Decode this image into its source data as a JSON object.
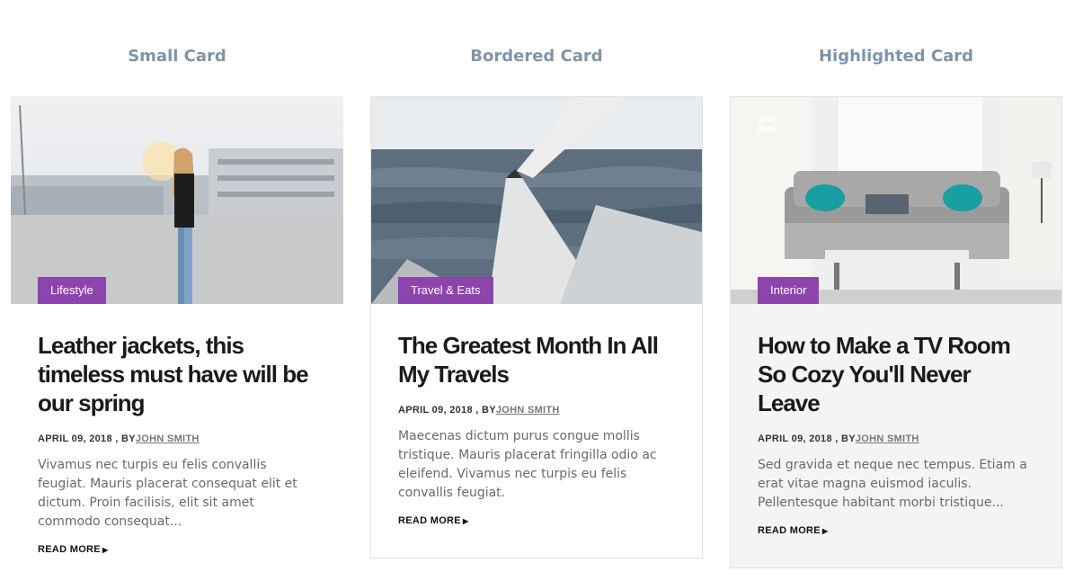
{
  "columns": [
    {
      "heading": "Small Card"
    },
    {
      "heading": "Bordered Card"
    },
    {
      "heading": "Highlighted Card"
    }
  ],
  "cards": [
    {
      "category": "Lifestyle",
      "title": "Leather jackets, this timeless must have will be our spring",
      "date": "APRIL 09, 2018",
      "by": " , BY",
      "author": "JOHN SMITH",
      "excerpt": "Vivamus nec turpis eu felis convallis feugiat. Mauris placerat consequat elit et dictum. Proin facilisis, elit sit amet commodo consequat...",
      "read_more": "READ MORE"
    },
    {
      "category": "Travel & Eats",
      "title": "The Greatest Month In All My Travels",
      "date": "APRIL 09, 2018",
      "by": " , BY",
      "author": "JOHN SMITH",
      "excerpt": "Maecenas dictum purus congue mollis tristique. Mauris placerat fringilla odio ac eleifend. Vivamus nec turpis eu felis convallis feugiat.",
      "read_more": "READ MORE"
    },
    {
      "category": "Interior",
      "title": "How to Make a TV Room So Cozy You'll Never Leave",
      "date": "APRIL 09, 2018",
      "by": " , BY",
      "author": "JOHN SMITH",
      "excerpt": "Sed gravida et neque nec tempus. Etiam a erat vitae magna euismod iaculis. Pellentesque habitant morbi tristique...",
      "read_more": "READ MORE"
    }
  ],
  "colors": {
    "tag": "#8e44ad",
    "heading": "#7f95a6",
    "highlight_bg": "#f4f4f4"
  },
  "icons": [
    "gallery-icon",
    "caret-right-icon"
  ]
}
